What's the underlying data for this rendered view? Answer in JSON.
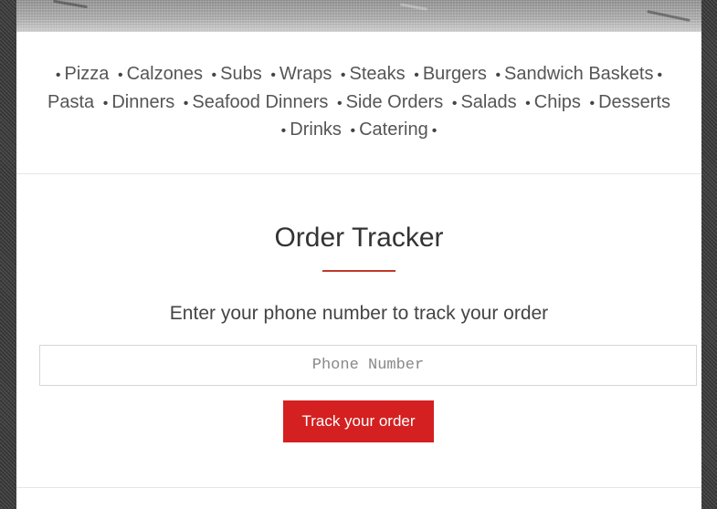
{
  "nav": {
    "separator": "•",
    "items": [
      {
        "label": "Pizza"
      },
      {
        "label": "Calzones"
      },
      {
        "label": "Subs"
      },
      {
        "label": "Wraps"
      },
      {
        "label": "Steaks"
      },
      {
        "label": "Burgers"
      },
      {
        "label": "Sandwich Baskets"
      },
      {
        "label": "Pasta"
      },
      {
        "label": "Dinners"
      },
      {
        "label": "Seafood Dinners"
      },
      {
        "label": "Side Orders"
      },
      {
        "label": "Salads"
      },
      {
        "label": "Chips"
      },
      {
        "label": "Desserts"
      },
      {
        "label": "Drinks"
      },
      {
        "label": "Catering"
      }
    ]
  },
  "tracker": {
    "title": "Order Tracker",
    "subtitle": "Enter your phone number to track your order",
    "phone_value": "",
    "phone_placeholder": "Phone Number",
    "button_label": "Track your order"
  },
  "colors": {
    "accent": "#d42020",
    "title_rule": "#c0392b",
    "text": "#333333",
    "page_background": "#ffffff",
    "body_background": "#454545"
  }
}
